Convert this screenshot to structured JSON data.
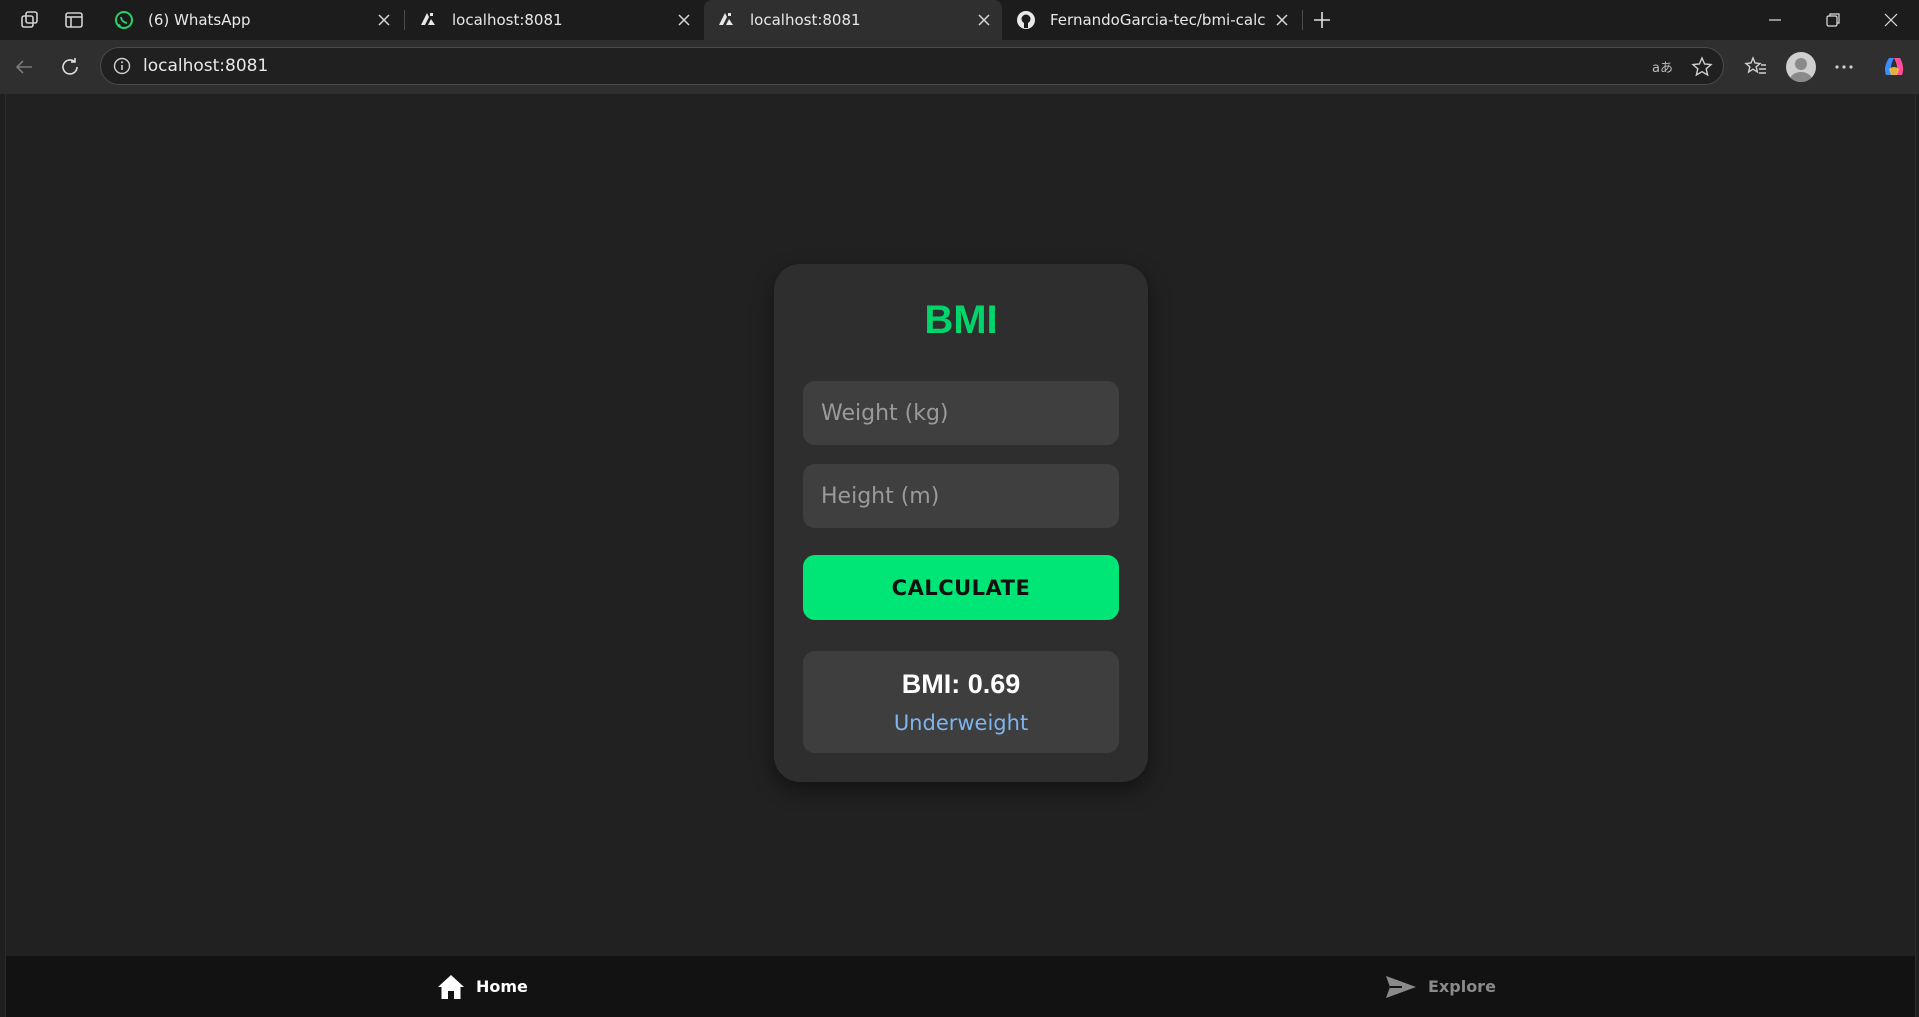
{
  "browser": {
    "tabs": [
      {
        "title": "(6) WhatsApp",
        "favicon": "whatsapp-icon",
        "active": false
      },
      {
        "title": "localhost:8081",
        "favicon": "expo-icon",
        "active": false
      },
      {
        "title": "localhost:8081",
        "favicon": "expo-icon",
        "active": true
      },
      {
        "title": "FernandoGarcia-tec/bmi-calculato",
        "favicon": "github-icon",
        "active": false
      }
    ],
    "address": "localhost:8081"
  },
  "app": {
    "title": "BMI",
    "weight_placeholder": "Weight (kg)",
    "height_placeholder": "Height (m)",
    "calculate_label": "CALCULATE",
    "result_value": "BMI: 0.69",
    "result_category": "Underweight",
    "accent_color": "#00e676",
    "category_color": "#7fb4ef"
  },
  "bottom_nav": {
    "home_label": "Home",
    "explore_label": "Explore"
  }
}
